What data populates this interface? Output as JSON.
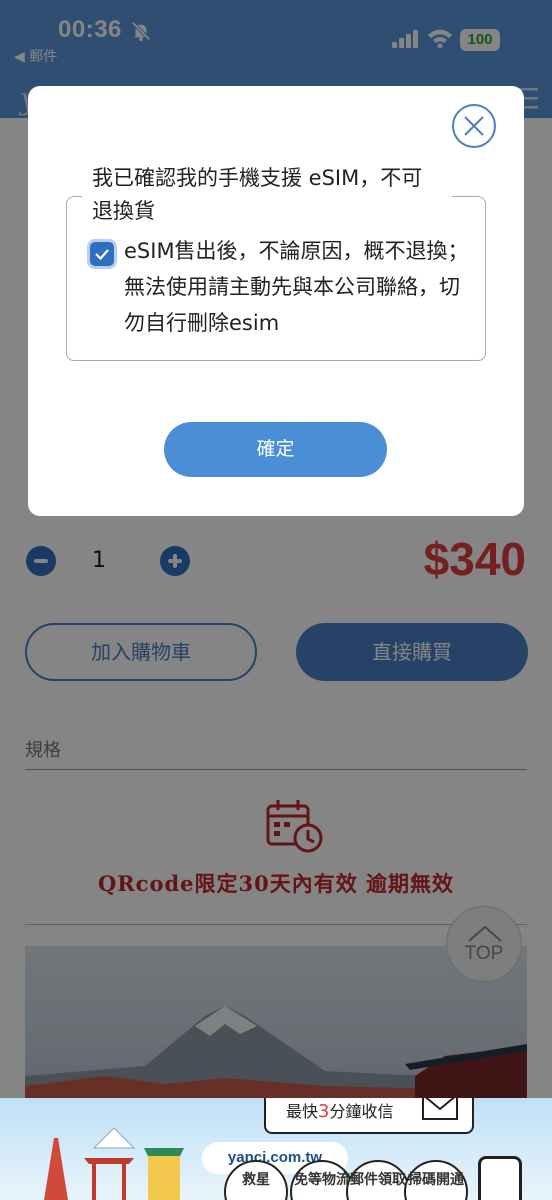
{
  "status_bar": {
    "time": "00:36",
    "back_label": "◀ 郵件",
    "battery": "100"
  },
  "site": {
    "logo": "yanci"
  },
  "product": {
    "quantity": "1",
    "price": "$340",
    "add_to_cart": "加入購物車",
    "buy_now": "直接購買",
    "spec_label": "規格",
    "qr_notice": "QRcode限定30天內有效 逾期無效"
  },
  "top_button": "TOP",
  "dialog": {
    "legend": "我已確認我的手機支援 eSIM，不可退換貨",
    "checkbox_label": "eSIM售出後，不論原因，概不退換；無法使用請主動先與本公司聯絡，切勿自行刪除esim",
    "checkbox_checked": true,
    "confirm": "確定"
  },
  "footer_ad": {
    "bubble_prefix": "最快",
    "bubble_highlight": "3",
    "bubble_suffix": "分鐘收信",
    "url": "yanci.com.tw",
    "badges": [
      "救星",
      "免等物流",
      "郵件領取",
      "掃碼開通"
    ]
  },
  "colors": {
    "accent": "#4a7fc4",
    "price": "#e23c3c",
    "notice": "#c02828"
  }
}
